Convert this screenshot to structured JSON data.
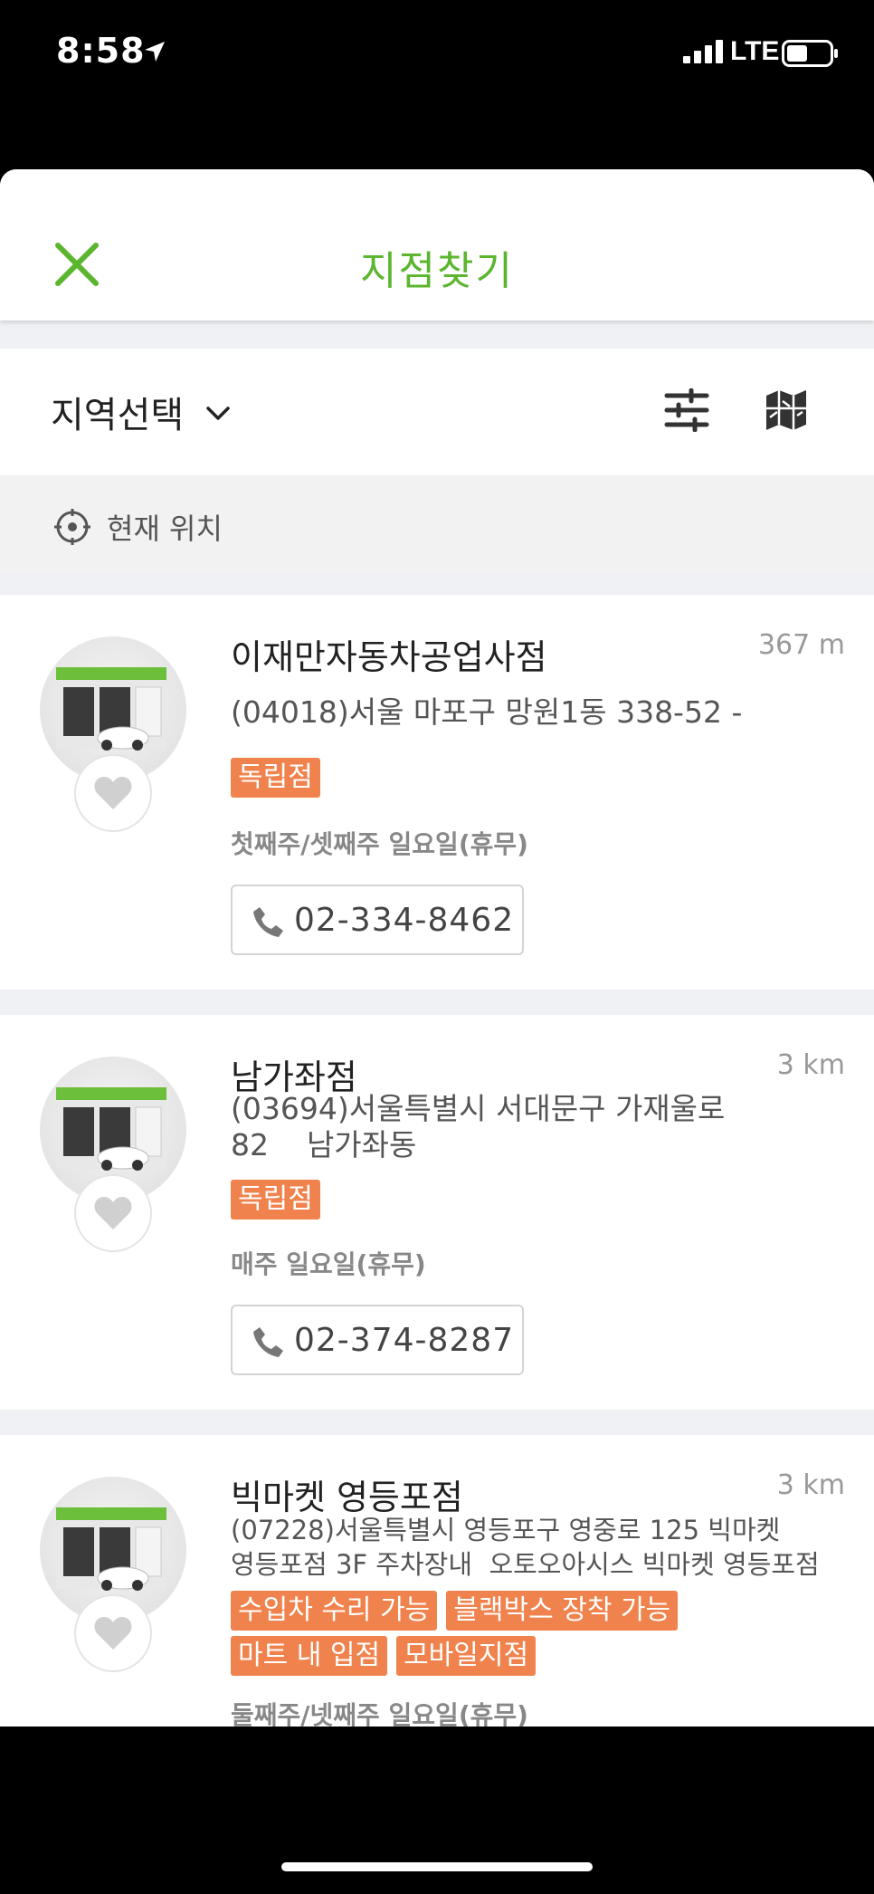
{
  "status": {
    "time": "8:58",
    "network": "LTE"
  },
  "nav": {
    "title": "지점찾기"
  },
  "filter": {
    "region_label": "지역선택"
  },
  "location": {
    "label": "현재 위치"
  },
  "stores": [
    {
      "name": "이재만자동차공업사점",
      "distance": "367 m",
      "address_lines": [
        "(04018)서울 마포구 망원1동 338-52 -"
      ],
      "tags": [
        "독립점"
      ],
      "hours": "첫째주/셋째주 일요일(휴무)",
      "phone": "02-334-8462"
    },
    {
      "name": "남가좌점",
      "distance": "3 km",
      "address_lines": [
        "(03694)서울특별시 서대문구 가재울로",
        "82    남가좌동"
      ],
      "tags": [
        "독립점"
      ],
      "hours": "매주 일요일(휴무)",
      "phone": "02-374-8287"
    },
    {
      "name": "빅마켓 영등포점",
      "distance": "3 km",
      "address_lines": [
        "(07228)서울특별시 영등포구 영중로 125 빅마켓",
        "영등포점 3F 주차장내  오토오아시스 빅마켓 영등포점"
      ],
      "tags_row1": [
        "수입차 수리 가능",
        "블랙박스 장착 가능"
      ],
      "tags_row2": [
        "마트 내 입점",
        "모바일지점"
      ],
      "hours": "둘째주/넷째주 일요일(휴무)"
    }
  ],
  "colors": {
    "brand_green": "#5bb52f",
    "tag_orange": "#f0834d"
  }
}
